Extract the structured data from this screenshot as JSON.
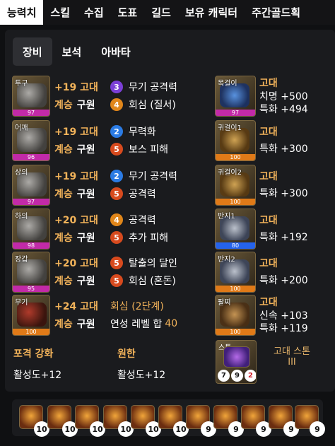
{
  "top_tabs": [
    {
      "label": "능력치",
      "active": true
    },
    {
      "label": "스킬",
      "active": false
    },
    {
      "label": "수집",
      "active": false
    },
    {
      "label": "도표",
      "active": false
    },
    {
      "label": "길드",
      "active": false
    },
    {
      "label": "보유 캐릭터",
      "active": false
    },
    {
      "label": "주간골드획",
      "active": false
    }
  ],
  "sub_tabs": [
    {
      "label": "장비",
      "active": true
    },
    {
      "label": "보석",
      "active": false
    },
    {
      "label": "아바타",
      "active": false
    }
  ],
  "equipment": [
    {
      "slot": "투구",
      "quality": "97",
      "upgrade": "+19 고대",
      "succession_label": "계승",
      "succession": "구원",
      "eng1_level": "3",
      "eng1_name": "무기 공격력",
      "eng2_level": "4",
      "eng2_name": "회심 (질서)"
    },
    {
      "slot": "어깨",
      "quality": "96",
      "upgrade": "+19 고대",
      "succession_label": "계승",
      "succession": "구원",
      "eng1_level": "2",
      "eng1_name": "무력화",
      "eng2_level": "5",
      "eng2_name": "보스 피해"
    },
    {
      "slot": "상의",
      "quality": "97",
      "upgrade": "+19 고대",
      "succession_label": "계승",
      "succession": "구원",
      "eng1_level": "2",
      "eng1_name": "무기 공격력",
      "eng2_level": "5",
      "eng2_name": "공격력"
    },
    {
      "slot": "하의",
      "quality": "98",
      "upgrade": "+20 고대",
      "succession_label": "계승",
      "succession": "구원",
      "eng1_level": "4",
      "eng1_name": "공격력",
      "eng2_level": "5",
      "eng2_name": "추가 피해"
    },
    {
      "slot": "장갑",
      "quality": "95",
      "upgrade": "+20 고대",
      "succession_label": "계승",
      "succession": "구원",
      "eng1_level": "5",
      "eng1_name": "탈출의 달인",
      "eng2_level": "5",
      "eng2_name": "회심 (혼돈)"
    },
    {
      "slot": "무기",
      "quality": "100",
      "upgrade": "+24 고대",
      "succession_label": "계승",
      "succession": "구원",
      "eng1_text": "회심 (2단계)",
      "eng2_text": "연성 레벨 합",
      "eng2_value": "40"
    }
  ],
  "accessories": [
    {
      "slot": "목걸이",
      "quality": "97",
      "grade": "고대",
      "stat1": "치명 +500",
      "stat2": "특화 +494"
    },
    {
      "slot": "귀걸이1",
      "quality": "100",
      "grade": "고대",
      "stat1": "특화 +300"
    },
    {
      "slot": "귀걸이2",
      "quality": "100",
      "grade": "고대",
      "stat1": "특화 +300"
    },
    {
      "slot": "반지1",
      "quality": "80",
      "grade": "고대",
      "stat1": "특화 +192"
    },
    {
      "slot": "반지2",
      "quality": "100",
      "grade": "고대",
      "stat1": "특화 +200"
    },
    {
      "slot": "팔찌",
      "quality": "100",
      "grade": "고대",
      "stat1": "신속 +103",
      "stat2": "특화 +119"
    }
  ],
  "bottom": {
    "left_title": "포격 강화",
    "left_value": "활성도+12",
    "mid_title": "원한",
    "mid_value": "활성도+12"
  },
  "stone": {
    "slot": "스톤",
    "n1": "7",
    "n2": "9",
    "n3": "2",
    "name_line1": "고대 스톤",
    "name_line2": "III"
  },
  "gems": [
    "10",
    "10",
    "10",
    "10",
    "10",
    "10",
    "9",
    "9",
    "9",
    "9",
    "9"
  ],
  "colors": {
    "accent": "#f2b35a",
    "background": "#0f1012",
    "panel": "#1a1b1e"
  }
}
